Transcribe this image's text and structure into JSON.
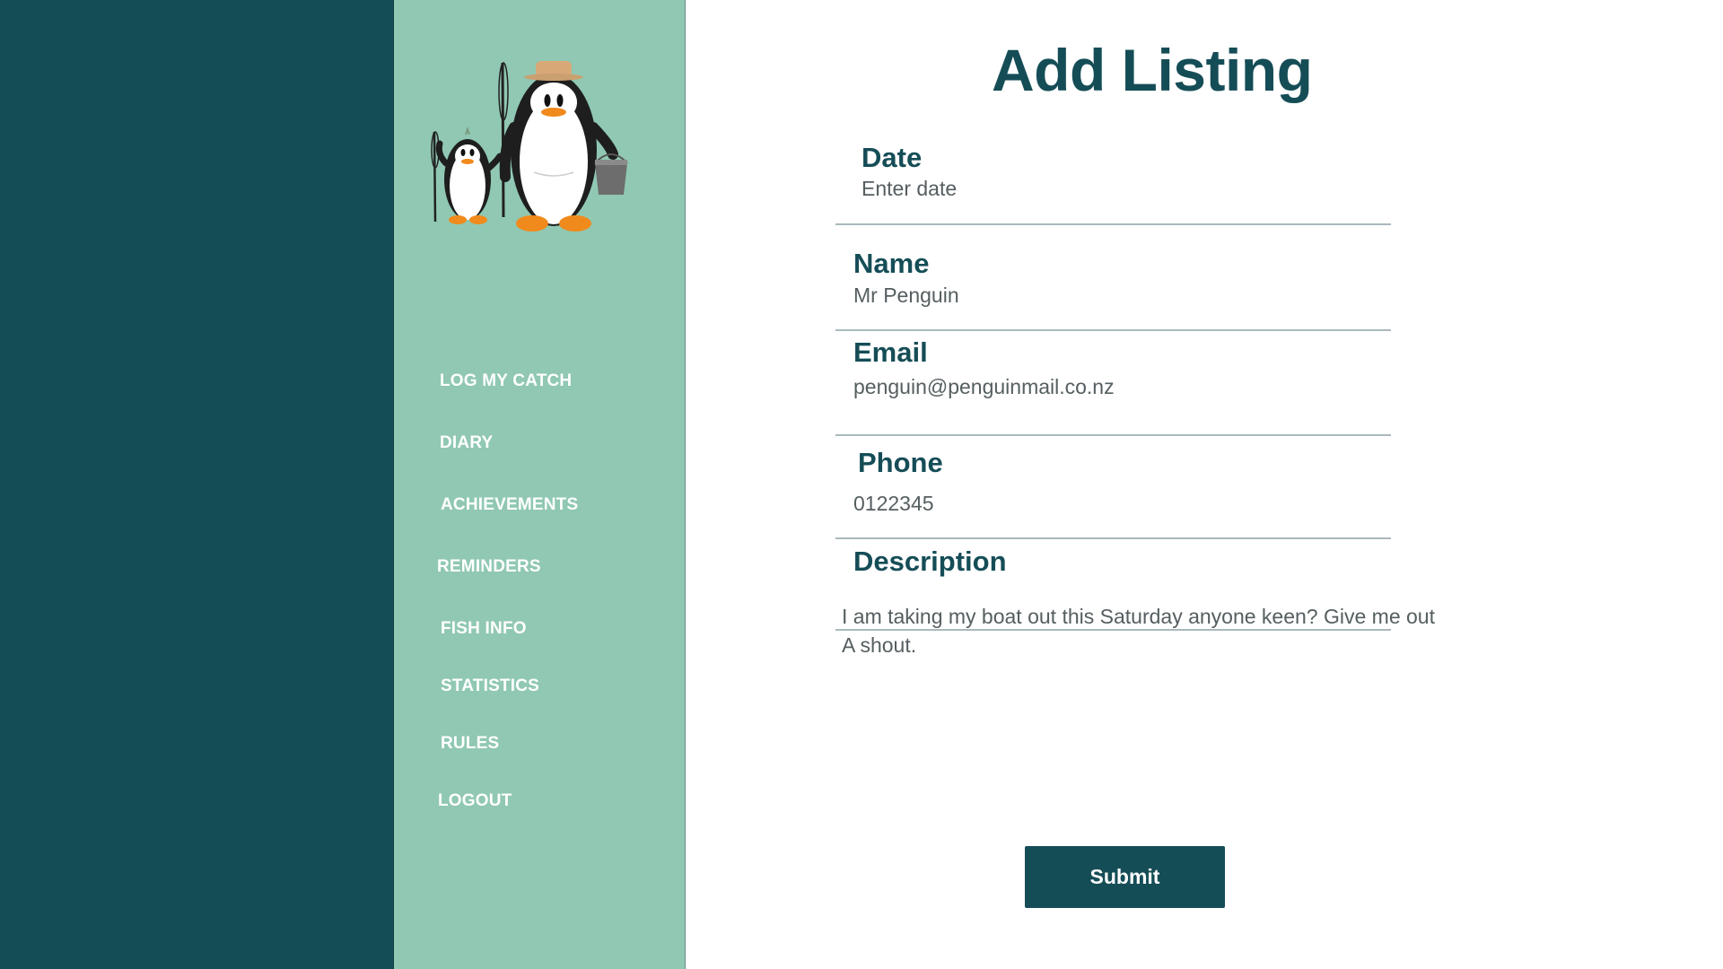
{
  "page": {
    "title": "Add Listing"
  },
  "sidebar": {
    "logo": "penguin-family-fishing-logo",
    "items": [
      {
        "label": "LOG MY CATCH"
      },
      {
        "label": "DIARY"
      },
      {
        "label": "ACHIEVEMENTS"
      },
      {
        "label": "REMINDERS"
      },
      {
        "label": "FISH INFO"
      },
      {
        "label": "STATISTICS"
      },
      {
        "label": "RULES"
      },
      {
        "label": "LOGOUT"
      }
    ]
  },
  "form": {
    "date": {
      "label": "Date",
      "value": "",
      "placeholder": "Enter date"
    },
    "name": {
      "label": "Name",
      "value": "Mr Penguin"
    },
    "email": {
      "label": "Email",
      "value": "penguin@penguinmail.co.nz"
    },
    "phone": {
      "label": "Phone",
      "value": "0122345"
    },
    "description": {
      "label": "Description",
      "line1": "I am taking my boat out this Saturday anyone keen? Give me out",
      "line2": "A shout."
    },
    "submit_label": "Submit"
  },
  "colors": {
    "primary": "#154d57",
    "sidebar": "#90c8b3",
    "text_muted": "#555e60",
    "divider": "#aab8bc",
    "penguin_beak": "#f08a1c",
    "hat": "#d9a877"
  }
}
